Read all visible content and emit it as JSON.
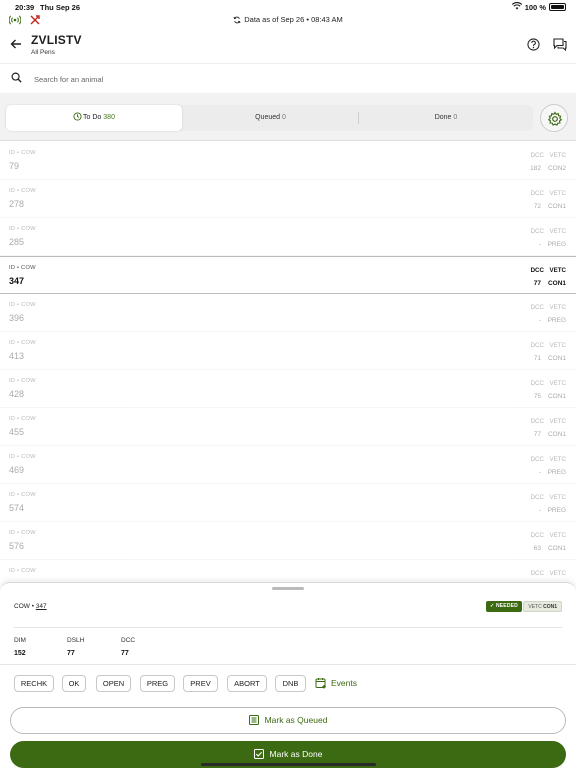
{
  "status_bar": {
    "time": "20:39",
    "date": "Thu Sep 26",
    "battery": "100 %"
  },
  "sync": {
    "text": "Data as of Sep 26 • 08:43 AM"
  },
  "header": {
    "title": "ZVLISTV",
    "subtitle": "All Pens"
  },
  "search": {
    "placeholder": "Search for an animal"
  },
  "tabs": [
    {
      "label": "To Do",
      "count": "380"
    },
    {
      "label": "Queued",
      "count": "0"
    },
    {
      "label": "Done",
      "count": "0"
    }
  ],
  "list_headers": {
    "id_label": "ID • COW",
    "dcc": "DCC",
    "vetc": "VETC"
  },
  "rows": [
    {
      "id": "79",
      "dcc": "182",
      "vetc": "CON2",
      "selected": false
    },
    {
      "id": "278",
      "dcc": "72",
      "vetc": "CON1",
      "selected": false
    },
    {
      "id": "285",
      "dcc": "-",
      "vetc": "PREG",
      "selected": false
    },
    {
      "id": "347",
      "dcc": "77",
      "vetc": "CON1",
      "selected": true
    },
    {
      "id": "396",
      "dcc": "-",
      "vetc": "PREG",
      "selected": false
    },
    {
      "id": "413",
      "dcc": "71",
      "vetc": "CON1",
      "selected": false
    },
    {
      "id": "428",
      "dcc": "75",
      "vetc": "CON1",
      "selected": false
    },
    {
      "id": "455",
      "dcc": "77",
      "vetc": "CON1",
      "selected": false
    },
    {
      "id": "469",
      "dcc": "-",
      "vetc": "PREG",
      "selected": false
    },
    {
      "id": "574",
      "dcc": "-",
      "vetc": "PREG",
      "selected": false
    },
    {
      "id": "576",
      "dcc": "63",
      "vetc": "CON1",
      "selected": false
    },
    {
      "id": "",
      "dcc": "",
      "vetc": "",
      "selected": false
    }
  ],
  "sheet": {
    "cow_prefix": "COW • ",
    "cow_id": "347",
    "badge_needed": "NEEDED",
    "badge_vetc_label": "VETC",
    "badge_vetc_value": "CON1",
    "stats": [
      {
        "key": "DIM",
        "value": "152"
      },
      {
        "key": "DSLH",
        "value": "77"
      },
      {
        "key": "DCC",
        "value": "77"
      }
    ],
    "actions": [
      "RECHK",
      "OK",
      "OPEN",
      "PREG",
      "PREV",
      "ABORT",
      "DNB"
    ],
    "events_label": "Events",
    "queue_label": "Mark as Queued",
    "done_label": "Mark as Done"
  },
  "colors": {
    "accent_green": "#3b6a12",
    "muted_text": "#777777"
  }
}
